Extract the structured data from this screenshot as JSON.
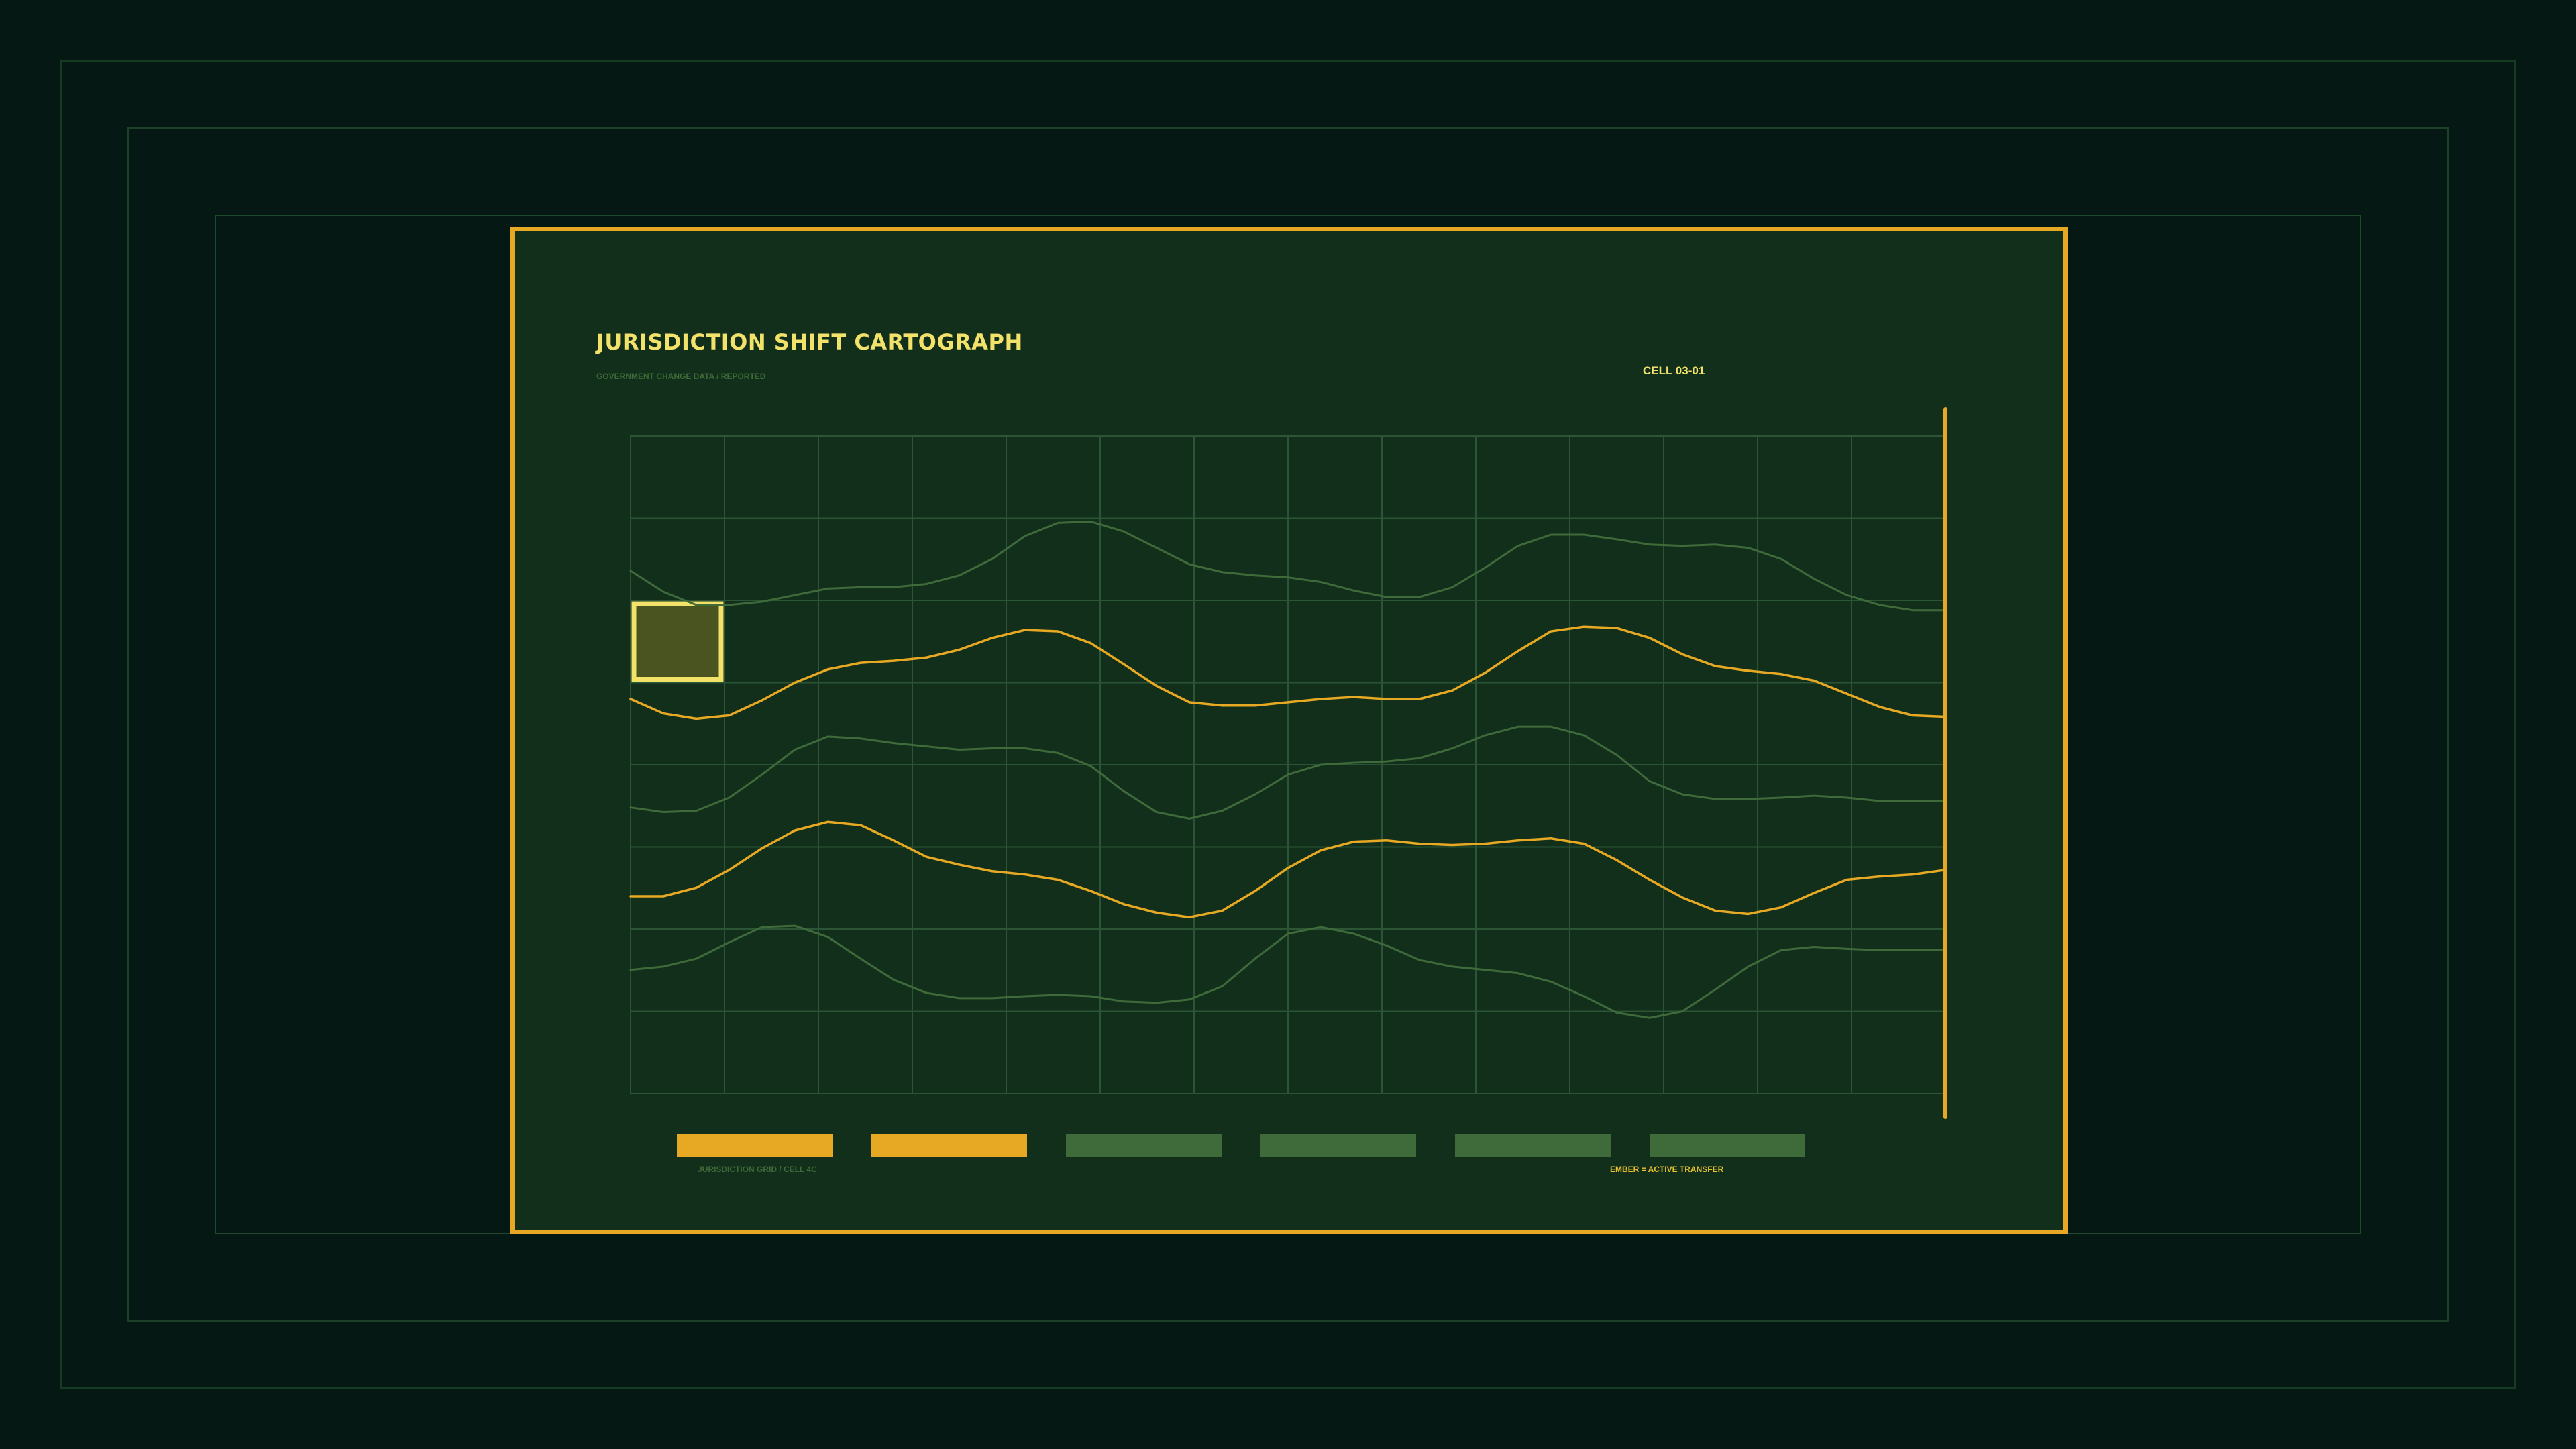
{
  "header": {
    "title": "JURISDICTION SHIFT CARTOGRAPH",
    "subtitle": "GOVERNMENT CHANGE DATA / REPORTED",
    "cell_label": "CELL 03-01"
  },
  "footer": {
    "left_label": "JURISDICTION GRID / CELL 4C",
    "right_label": "EMBER = ACTIVE TRANSFER"
  },
  "colors": {
    "background": "#061813",
    "panel": "#112f1b",
    "accent": "#e7a823",
    "title": "#f3e269",
    "muted_line": "#3f6a3a",
    "grid": "#2c5535",
    "highlight_fill": "#4a5421",
    "highlight_border": "#f3e269"
  },
  "chart_data": {
    "type": "line",
    "title": "",
    "xlabel": "",
    "ylabel": "",
    "grid": true,
    "grid_columns": 14,
    "grid_rows": 8,
    "xlim": [
      0,
      40
    ],
    "ylim": [
      0,
      100
    ],
    "x": [
      0,
      1,
      2,
      3,
      4,
      5,
      6,
      7,
      8,
      9,
      10,
      11,
      12,
      13,
      14,
      15,
      16,
      17,
      18,
      19,
      20,
      21,
      22,
      23,
      24,
      25,
      26,
      27,
      28,
      29,
      30,
      31,
      32,
      33,
      34,
      35,
      36,
      37,
      38,
      39,
      40
    ],
    "series": [
      {
        "style": "muted",
        "values": [
          79.5,
          76.3,
          74.3,
          74.3,
          74.8,
          75.8,
          76.8,
          77.0,
          77.0,
          77.5,
          78.8,
          81.3,
          84.8,
          86.8,
          87.0,
          85.5,
          83.0,
          80.5,
          79.3,
          78.8,
          78.5,
          77.8,
          76.5,
          75.5,
          75.5,
          77.0,
          80.0,
          83.3,
          85.0,
          85.0,
          84.3,
          83.5,
          83.3,
          83.5,
          83.0,
          81.3,
          78.3,
          75.8,
          74.3,
          73.5,
          73.5
        ]
      },
      {
        "style": "accent",
        "values": [
          60.0,
          57.8,
          57.0,
          57.5,
          59.8,
          62.5,
          64.5,
          65.5,
          65.8,
          66.3,
          67.5,
          69.3,
          70.5,
          70.3,
          68.5,
          65.3,
          62.0,
          59.5,
          59.0,
          59.0,
          59.5,
          60.0,
          60.3,
          60.0,
          60.0,
          61.3,
          64.0,
          67.3,
          70.3,
          71.0,
          70.8,
          69.3,
          66.8,
          65.0,
          64.3,
          63.8,
          62.8,
          60.8,
          58.8,
          57.5,
          57.3
        ]
      },
      {
        "style": "muted",
        "values": [
          43.5,
          42.8,
          43.0,
          45.0,
          48.5,
          52.3,
          54.3,
          54.0,
          53.3,
          52.8,
          52.3,
          52.5,
          52.5,
          51.8,
          49.8,
          46.0,
          42.8,
          41.8,
          43.0,
          45.5,
          48.5,
          50.0,
          50.3,
          50.5,
          51.0,
          52.5,
          54.5,
          55.8,
          55.8,
          54.5,
          51.5,
          47.5,
          45.5,
          44.8,
          44.8,
          45.0,
          45.3,
          45.0,
          44.5,
          44.5,
          44.5
        ]
      },
      {
        "style": "accent",
        "values": [
          30.0,
          30.0,
          31.3,
          34.0,
          37.3,
          40.0,
          41.3,
          40.8,
          38.5,
          36.0,
          34.8,
          33.8,
          33.3,
          32.5,
          30.8,
          28.8,
          27.5,
          26.8,
          27.8,
          30.8,
          34.3,
          37.0,
          38.3,
          38.5,
          38.0,
          37.8,
          38.0,
          38.5,
          38.8,
          38.0,
          35.5,
          32.5,
          29.8,
          27.8,
          27.3,
          28.3,
          30.5,
          32.5,
          33.0,
          33.3,
          34.0
        ]
      },
      {
        "style": "muted",
        "values": [
          18.8,
          19.3,
          20.5,
          23.0,
          25.3,
          25.5,
          23.8,
          20.5,
          17.3,
          15.3,
          14.5,
          14.5,
          14.8,
          15.0,
          14.8,
          14.0,
          13.8,
          14.3,
          16.3,
          20.5,
          24.3,
          25.3,
          24.3,
          22.5,
          20.3,
          19.3,
          18.8,
          18.3,
          17.0,
          14.8,
          12.3,
          11.5,
          12.5,
          15.8,
          19.3,
          21.8,
          22.3,
          22.0,
          21.8,
          21.8,
          21.8
        ]
      }
    ],
    "legend_swatches": [
      {
        "style": "accent"
      },
      {
        "style": "accent"
      },
      {
        "style": "muted"
      },
      {
        "style": "muted"
      },
      {
        "style": "muted"
      },
      {
        "style": "muted"
      }
    ],
    "highlight_cell": {
      "column": 0,
      "row": 2
    }
  }
}
